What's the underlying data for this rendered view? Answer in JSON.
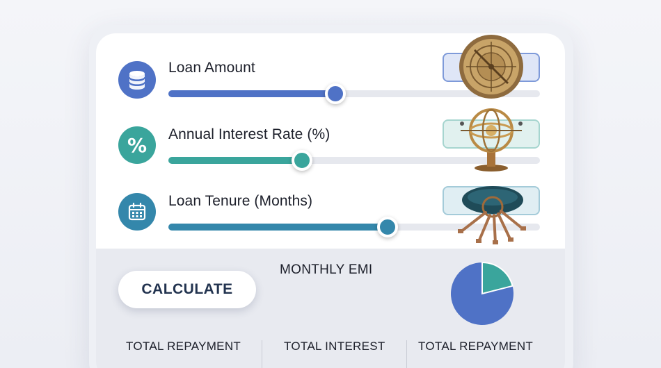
{
  "colors": {
    "loan_accent": "#4f72c6",
    "rate_accent": "#3aa59c",
    "tenure_accent": "#3487ab",
    "pie_primary": "#4f72c6",
    "pie_secondary": "#3aa59c"
  },
  "sliders": [
    {
      "id": "loan-amount",
      "label": "Loan Amount",
      "icon": "coin-stack-icon",
      "level_fraction": 0.45,
      "value_text": "",
      "illustration": "astrolabe-illustration"
    },
    {
      "id": "interest-rate",
      "label": "Annual Interest Rate (%)",
      "icon": "percent-icon",
      "level_fraction": 0.36,
      "value_text": "",
      "illustration": "armillary-sphere-illustration"
    },
    {
      "id": "loan-tenure",
      "label": "Loan Tenure (Months)",
      "icon": "calendar-icon",
      "level_fraction": 0.59,
      "value_text": "",
      "illustration": "key-ring-illustration"
    }
  ],
  "actions": {
    "calculate_label": "CALCULATE"
  },
  "results": {
    "monthly_emi_label": "MONTHLY EMI",
    "pie_secondary_fraction": 0.21,
    "footer": [
      "TOTAL REPAYMENT",
      "TOTAL INTEREST",
      "TOTAL REPAYMENT"
    ]
  }
}
